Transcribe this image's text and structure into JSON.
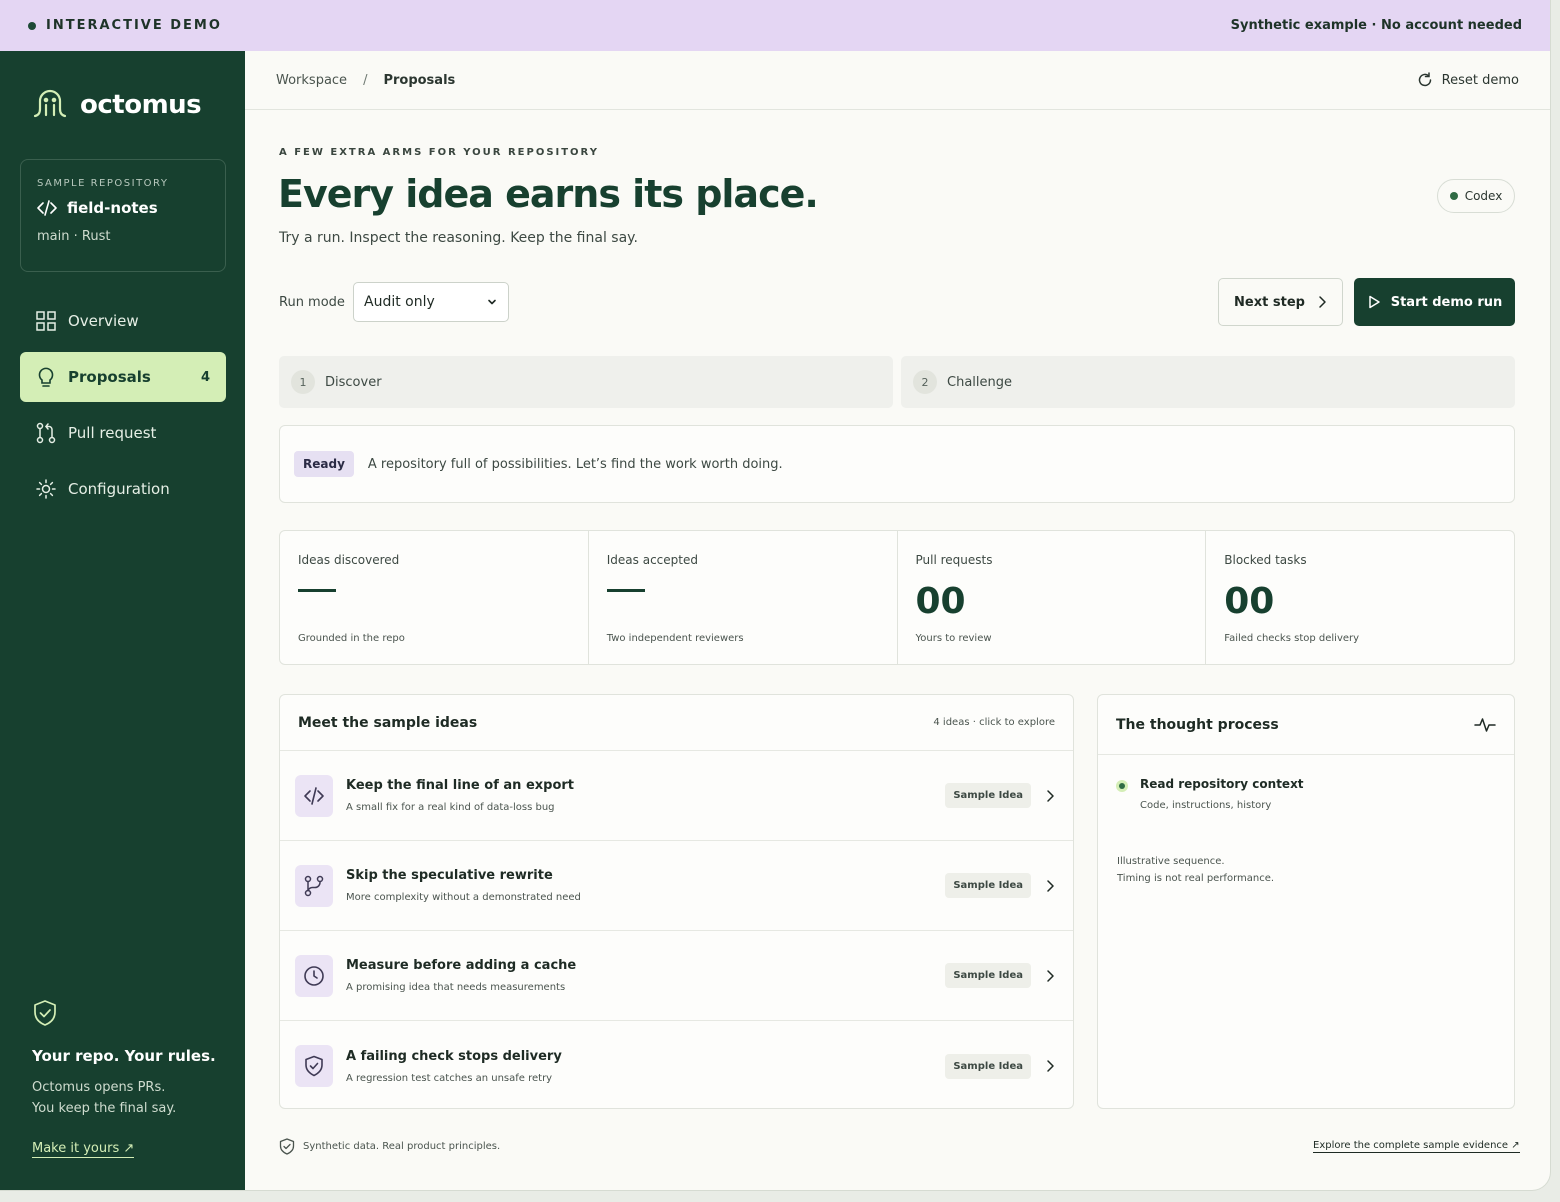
{
  "banner": {
    "title": "INTERACTIVE DEMO",
    "note": "Synthetic example · No account needed"
  },
  "sidebar": {
    "logo_text": "octomus",
    "repo": {
      "kicker": "SAMPLE REPOSITORY",
      "name": "field-notes",
      "meta": "main · Rust"
    },
    "items": [
      {
        "label": "Overview",
        "icon": "grid-icon"
      },
      {
        "label": "Proposals",
        "icon": "lightbulb-icon",
        "count": "4",
        "active": true
      },
      {
        "label": "Pull request",
        "icon": "pull-request-icon"
      },
      {
        "label": "Configuration",
        "icon": "gear-icon"
      }
    ],
    "footer": {
      "title": "Your repo. Your rules.",
      "line1": "Octomus opens PRs.",
      "line2": "You keep the final say.",
      "link": "Make it yours ↗"
    }
  },
  "topbar": {
    "crumb_root": "Workspace",
    "crumb_sep": "/",
    "crumb_current": "Proposals",
    "reset_label": "Reset demo"
  },
  "hero": {
    "kicker": "A FEW EXTRA ARMS FOR YOUR REPOSITORY",
    "headline": "Every idea earns its place.",
    "subline": "Try a run. Inspect the reasoning. Keep the final say.",
    "badge": "Codex"
  },
  "controls": {
    "run_mode_label": "Run mode",
    "run_mode_value": "Audit only",
    "next_label": "Next step",
    "start_label": "Start demo run"
  },
  "steps": [
    {
      "num": "1",
      "label": "Discover"
    },
    {
      "num": "2",
      "label": "Challenge"
    }
  ],
  "status": {
    "badge": "Ready",
    "text": "A repository full of possibilities. Let’s find the work worth doing."
  },
  "stats": [
    {
      "label": "Ideas discovered",
      "value": "",
      "sub": "Grounded in the repo"
    },
    {
      "label": "Ideas accepted",
      "value": "",
      "sub": "Two independent reviewers"
    },
    {
      "label": "Pull requests",
      "value": "00",
      "sub": "Yours to review"
    },
    {
      "label": "Blocked tasks",
      "value": "00",
      "sub": "Failed checks stop delivery"
    }
  ],
  "ideas": {
    "title": "Meet the sample ideas",
    "meta": "4 ideas · click to explore",
    "items": [
      {
        "title": "Keep the final line of an export",
        "sub": "A small fix for a real kind of data-loss bug",
        "tag": "Sample Idea",
        "icon": "code-icon"
      },
      {
        "title": "Skip the speculative rewrite",
        "sub": "More complexity without a demonstrated need",
        "tag": "Sample Idea",
        "icon": "branch-icon"
      },
      {
        "title": "Measure before adding a cache",
        "sub": "A promising idea that needs measurements",
        "tag": "Sample Idea",
        "icon": "clock-icon"
      },
      {
        "title": "A failing check stops delivery",
        "sub": "A regression test catches an unsafe retry",
        "tag": "Sample Idea",
        "icon": "shield-check-icon"
      }
    ]
  },
  "thought": {
    "title": "The thought process",
    "item_title": "Read repository context",
    "item_sub": "Code, instructions, history",
    "note1": "Illustrative sequence.",
    "note2": "Timing is not real performance."
  },
  "footer": {
    "note": "Synthetic data. Real product principles.",
    "link": "Explore the complete sample evidence ↗"
  },
  "colors": {
    "sidebar_bg": "#17402f",
    "accent_green": "#d4eeb6",
    "banner_bg": "#e4d6f3",
    "primary": "#17402f"
  }
}
